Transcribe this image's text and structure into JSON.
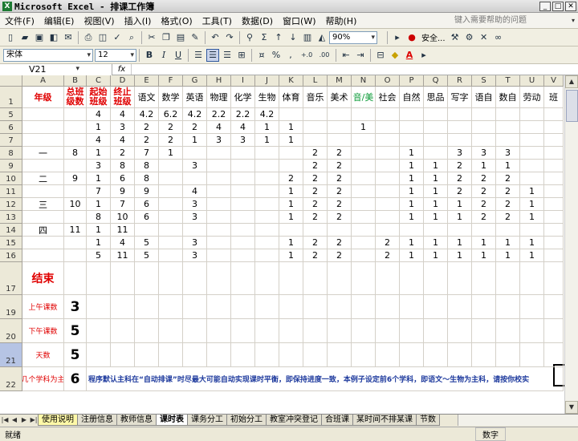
{
  "window": {
    "title": "Microsoft Excel - 排课工作簿",
    "min": "_",
    "max": "□",
    "close": "✕"
  },
  "menu": [
    "文件(F)",
    "编辑(E)",
    "视图(V)",
    "插入(I)",
    "格式(O)",
    "工具(T)",
    "数据(D)",
    "窗口(W)",
    "帮助(H)"
  ],
  "help_placeholder": "键入需要帮助的问题",
  "toolbar": {
    "zoom": "90%",
    "security": "安全...",
    "font_name": "宋体",
    "font_size": "12",
    "bold": "B",
    "italic": "I",
    "underline": "U",
    "percent": "%",
    "comma": ",",
    "inc_decimal": "+.0",
    "dec_decimal": ".00"
  },
  "formula": {
    "name_box": "V21",
    "fx": "fx",
    "content": ""
  },
  "columns": [
    "A",
    "B",
    "C",
    "D",
    "E",
    "F",
    "G",
    "H",
    "I",
    "J",
    "K",
    "L",
    "M",
    "N",
    "O",
    "P",
    "Q",
    "R",
    "S",
    "T",
    "U",
    "V"
  ],
  "rows": [
    {
      "num": "1",
      "cells": [
        "年级",
        "总班级数",
        "起始班级",
        "终止班级",
        "语文",
        "数学",
        "英语",
        "物理",
        "化学",
        "生物",
        "体育",
        "音乐",
        "美术",
        "音/美",
        "社会",
        "自然",
        "思品",
        "写字",
        "语自",
        "数自",
        "劳动",
        "班"
      ]
    },
    {
      "num": "5",
      "cells": [
        "",
        "",
        "4",
        "4",
        "4.2",
        "6.2",
        "4.2",
        "2.2",
        "2.2",
        "4.2",
        "",
        "",
        "",
        "",
        "",
        "",
        "",
        "",
        "",
        "",
        "",
        ""
      ]
    },
    {
      "num": "6",
      "cells": [
        "",
        "",
        "1",
        "3",
        "2",
        "2",
        "2",
        "4",
        "4",
        "1",
        "1",
        "",
        "",
        "1",
        "",
        "",
        "",
        "",
        "",
        "",
        "",
        ""
      ]
    },
    {
      "num": "7",
      "cells": [
        "",
        "",
        "4",
        "4",
        "2",
        "2",
        "1",
        "3",
        "3",
        "1",
        "1",
        "",
        "",
        "",
        "",
        "",
        "",
        "",
        "",
        "",
        "",
        ""
      ]
    },
    {
      "num": "8",
      "cells": [
        "一",
        "8",
        "1",
        "2",
        "7",
        "1",
        "",
        "",
        "",
        "",
        "",
        "2",
        "2",
        "",
        "",
        "1",
        "",
        "3",
        "3",
        "3",
        "",
        ""
      ]
    },
    {
      "num": "9",
      "cells": [
        "",
        "",
        "3",
        "8",
        "8",
        "",
        "3",
        "",
        "",
        "",
        "",
        "2",
        "2",
        "",
        "",
        "1",
        "1",
        "2",
        "1",
        "1",
        "",
        ""
      ]
    },
    {
      "num": "10",
      "cells": [
        "二",
        "9",
        "1",
        "6",
        "8",
        "",
        "",
        "",
        "",
        "",
        "2",
        "2",
        "2",
        "",
        "",
        "1",
        "1",
        "2",
        "2",
        "2",
        "",
        ""
      ]
    },
    {
      "num": "11",
      "cells": [
        "",
        "",
        "7",
        "9",
        "9",
        "",
        "4",
        "",
        "",
        "",
        "1",
        "2",
        "2",
        "",
        "",
        "1",
        "1",
        "2",
        "2",
        "2",
        "1",
        ""
      ]
    },
    {
      "num": "12",
      "cells": [
        "三",
        "10",
        "1",
        "7",
        "6",
        "",
        "3",
        "",
        "",
        "",
        "1",
        "2",
        "2",
        "",
        "",
        "1",
        "1",
        "1",
        "2",
        "2",
        "1",
        ""
      ]
    },
    {
      "num": "13",
      "cells": [
        "",
        "",
        "8",
        "10",
        "6",
        "",
        "3",
        "",
        "",
        "",
        "1",
        "2",
        "2",
        "",
        "",
        "1",
        "1",
        "1",
        "2",
        "2",
        "1",
        ""
      ]
    },
    {
      "num": "14",
      "cells": [
        "四",
        "11",
        "1",
        "11",
        "",
        "",
        "",
        "",
        "",
        "",
        "",
        "",
        "",
        "",
        "",
        "",
        "",
        "",
        "",
        "",
        "",
        ""
      ]
    },
    {
      "num": "15",
      "cells": [
        "",
        "",
        "1",
        "4",
        "5",
        "",
        "3",
        "",
        "",
        "",
        "1",
        "2",
        "2",
        "",
        "2",
        "1",
        "1",
        "1",
        "1",
        "1",
        "1",
        ""
      ]
    },
    {
      "num": "16",
      "cells": [
        "",
        "",
        "5",
        "11",
        "5",
        "",
        "3",
        "",
        "",
        "",
        "1",
        "2",
        "2",
        "",
        "2",
        "1",
        "1",
        "1",
        "1",
        "1",
        "1",
        ""
      ]
    }
  ],
  "settings_rows": [
    {
      "num": "17",
      "label": "结束",
      "value": ""
    },
    {
      "num": "19",
      "label": "上午课数",
      "value": "3"
    },
    {
      "num": "20",
      "label": "下午课数",
      "value": "5"
    },
    {
      "num": "21",
      "label": "天数",
      "value": "5"
    },
    {
      "num": "22",
      "label": "前几个学科为主科",
      "value": "6",
      "note": "程序默认主科在“自动排课”时尽最大可能自动实现课时平衡，即保持进度一致，本例子设定前6个学科，即语文～生物为主科，请按你校实"
    }
  ],
  "tabs": [
    "使用说明",
    "注册信息",
    "教师信息",
    "课时表",
    "课务分工",
    "初始分工",
    "教室冲突登记",
    "合班课",
    "某时间不排某课",
    "节数"
  ],
  "active_tab": "课时表",
  "status": {
    "ready": "就绪",
    "mode": "数字"
  }
}
